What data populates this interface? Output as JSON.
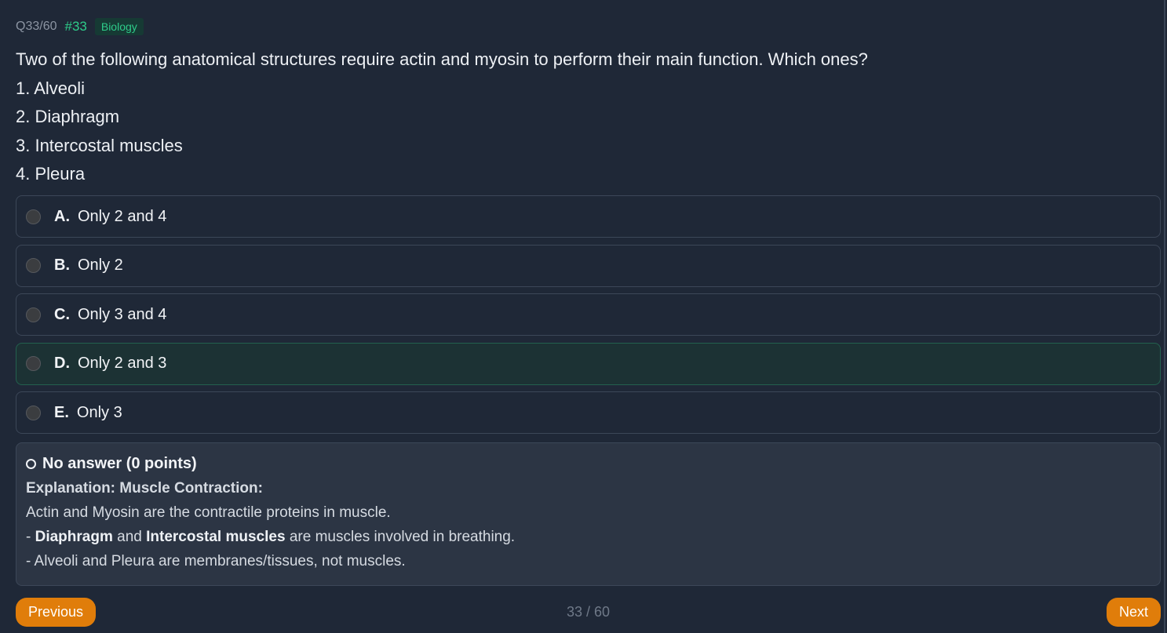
{
  "header": {
    "question_count": "Q33/60",
    "question_number": "#33",
    "category": "Biology"
  },
  "question": {
    "text": "Two of the following anatomical structures require actin and myosin to perform their main function. Which ones?",
    "items": [
      "1. Alveoli",
      "2. Diaphragm",
      "3. Intercostal muscles",
      "4. Pleura"
    ]
  },
  "options": [
    {
      "letter": "A.",
      "text": "Only 2 and 4"
    },
    {
      "letter": "B.",
      "text": "Only 2"
    },
    {
      "letter": "C.",
      "text": "Only 3 and 4"
    },
    {
      "letter": "D.",
      "text": "Only 2 and 3"
    },
    {
      "letter": "E.",
      "text": "Only 3"
    }
  ],
  "explanation": {
    "status": "No answer (0 points)",
    "title": "Explanation: Muscle Contraction:",
    "line1": "Actin and Myosin are the contractile proteins in muscle.",
    "line2_prefix": "- ",
    "line2_bold1": "Diaphragm",
    "line2_mid": " and ",
    "line2_bold2": "Intercostal muscles",
    "line2_suffix": " are muscles involved in breathing.",
    "line3": "- Alveoli and Pleura are membranes/tissues, not muscles."
  },
  "footer": {
    "previous_label": "Previous",
    "next_label": "Next",
    "page_indicator": "33 / 60"
  },
  "colors": {
    "background": "#1f2837",
    "accent": "#2ecc8a",
    "button": "#e07d0a",
    "correct_bg": "#1c3234"
  }
}
